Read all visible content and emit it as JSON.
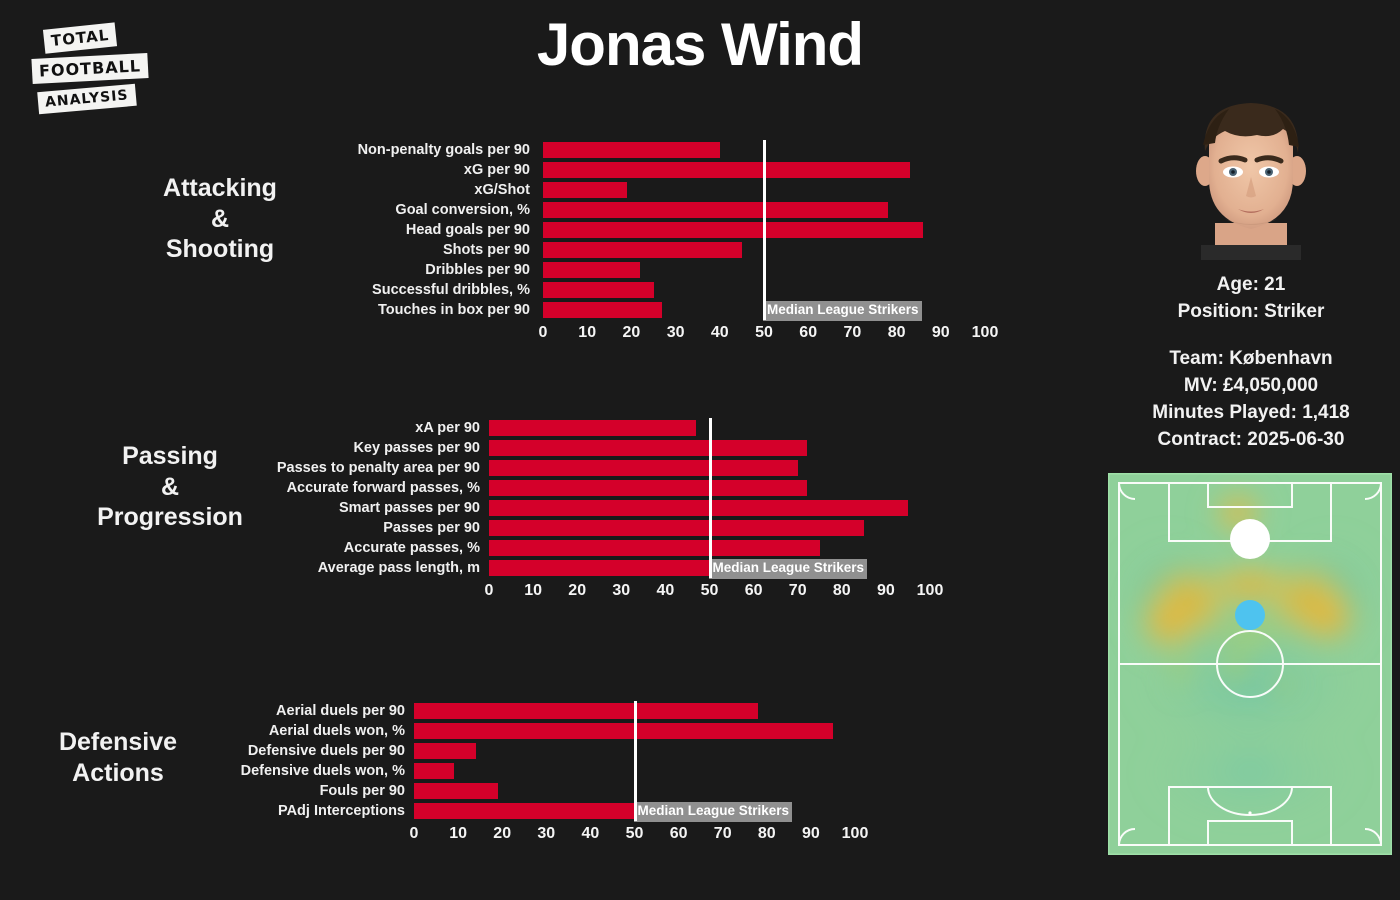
{
  "logo": {
    "line1": "TOTAL",
    "line2": "FOOTBALL",
    "line3": "ANALYSIS"
  },
  "header": {
    "title": "Jonas Wind"
  },
  "player": {
    "age": "Age: 21",
    "position": "Position: Striker",
    "team": "Team: København",
    "market_value": "MV: £4,050,000",
    "minutes": "Minutes Played: 1,418",
    "contract": "Contract: 2025-06-30"
  },
  "colors": {
    "bar": "#d4002a",
    "background": "#1a1a1a",
    "median_line": "#ffffff",
    "text": "#ffffff"
  },
  "median_label": "Median League Strikers",
  "chart_data": [
    {
      "type": "bar",
      "title": "Attacking\n&\nShooting",
      "title_lines": [
        "Attacking",
        "&",
        "Shooting"
      ],
      "orientation": "horizontal",
      "xlabel": "",
      "ylabel": "",
      "xlim": [
        0,
        100
      ],
      "xticks": [
        0,
        10,
        20,
        30,
        40,
        50,
        60,
        70,
        80,
        90,
        100
      ],
      "median_reference": 50,
      "median_label": "Median League Strikers",
      "grid": false,
      "categories": [
        "Non-penalty goals per 90",
        "xG per 90",
        "xG/Shot",
        "Goal conversion, %",
        "Head goals per 90",
        "Shots per 90",
        "Dribbles per 90",
        "Successful dribbles, %",
        "Touches in box per 90"
      ],
      "values": [
        40,
        83,
        19,
        78,
        86,
        45,
        22,
        25,
        27
      ]
    },
    {
      "type": "bar",
      "title": "Passing\n&\nProgression",
      "title_lines": [
        "Passing",
        "&",
        "Progression"
      ],
      "orientation": "horizontal",
      "xlabel": "",
      "ylabel": "",
      "xlim": [
        0,
        100
      ],
      "xticks": [
        0,
        10,
        20,
        30,
        40,
        50,
        60,
        70,
        80,
        90,
        100
      ],
      "median_reference": 50,
      "median_label": "Median League Strikers",
      "grid": false,
      "categories": [
        "xA per 90",
        "Key passes per 90",
        "Passes to penalty area per 90",
        "Accurate forward passes, %",
        "Smart passes per 90",
        "Passes per 90",
        "Accurate passes, %",
        "Average pass length, m"
      ],
      "values": [
        47,
        72,
        70,
        72,
        95,
        85,
        75,
        50
      ]
    },
    {
      "type": "bar",
      "title": "Defensive\nActions",
      "title_lines": [
        "Defensive",
        "Actions"
      ],
      "orientation": "horizontal",
      "xlabel": "",
      "ylabel": "",
      "xlim": [
        0,
        100
      ],
      "xticks": [
        0,
        10,
        20,
        30,
        40,
        50,
        60,
        70,
        80,
        90,
        100
      ],
      "median_reference": 50,
      "median_label": "Median League Strikers",
      "grid": false,
      "categories": [
        "Aerial duels per 90",
        "Aerial duels won, %",
        "Defensive duels per 90",
        "Defensive duels won, %",
        "Fouls per 90",
        "PAdj Interceptions"
      ],
      "values": [
        78,
        95,
        14,
        9,
        19,
        50
      ]
    }
  ]
}
